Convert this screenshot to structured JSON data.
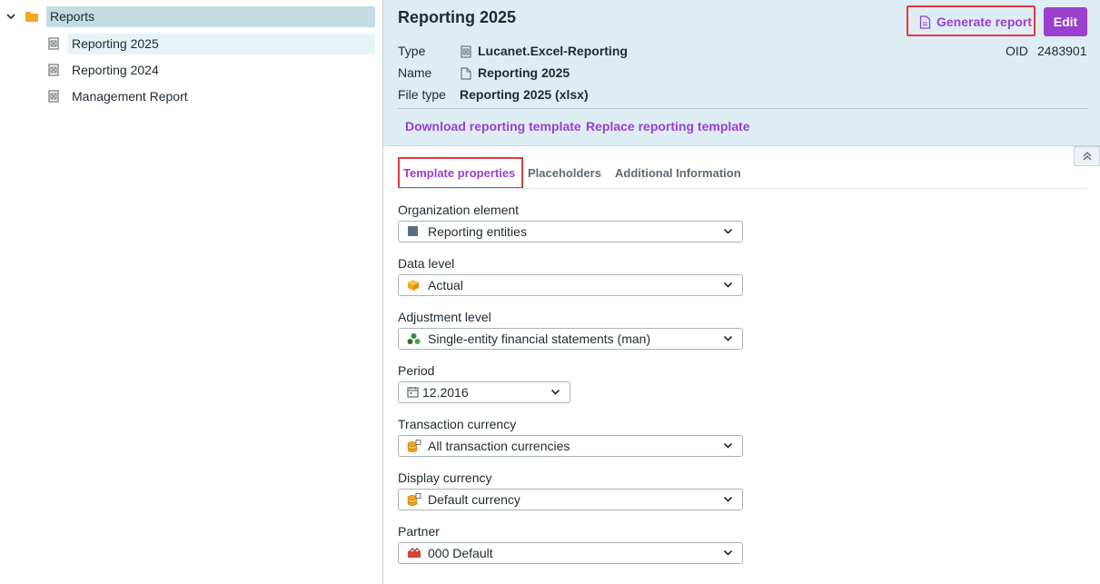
{
  "tree": {
    "root": {
      "label": "Reports"
    },
    "items": [
      {
        "label": "Reporting 2025",
        "selected": true
      },
      {
        "label": "Reporting 2024",
        "selected": false
      },
      {
        "label": "Management Report",
        "selected": false
      }
    ]
  },
  "header": {
    "title": "Reporting 2025",
    "generate_label": "Generate report",
    "edit_label": "Edit",
    "type_label": "Type",
    "type_value": "Lucanet.Excel-Reporting",
    "name_label": "Name",
    "name_value": "Reporting 2025",
    "file_type_label": "File type",
    "file_type_value": "Reporting 2025 (xlsx)",
    "oid_label": "OID",
    "oid_value": "2483901",
    "download_link": "Download reporting template",
    "replace_link": "Replace reporting template"
  },
  "tabs": [
    {
      "label": "Template properties",
      "active": true
    },
    {
      "label": "Placeholders",
      "active": false
    },
    {
      "label": "Additional Information",
      "active": false
    }
  ],
  "fields": {
    "org_element": {
      "label": "Organization element",
      "value": "Reporting entities",
      "icon": "square-entity-icon"
    },
    "data_level": {
      "label": "Data level",
      "value": "Actual",
      "icon": "cube-icon"
    },
    "adjustment_level": {
      "label": "Adjustment level",
      "value": "Single-entity financial statements (man)",
      "icon": "entities-icon"
    },
    "period": {
      "label": "Period",
      "value": "12.2016",
      "icon": "calendar-icon"
    },
    "transaction_currency": {
      "label": "Transaction currency",
      "value": "All transaction currencies",
      "icon": "coins-icon"
    },
    "display_currency": {
      "label": "Display currency",
      "value": "Default currency",
      "icon": "coins-icon"
    },
    "partner": {
      "label": "Partner",
      "value": "000 Default",
      "icon": "partner-icon"
    }
  },
  "colors": {
    "accent": "#9b3fcf",
    "highlight_border": "#e0393e",
    "header_bg": "#deedf4",
    "tree_selected_bg": "#c5dce4"
  }
}
